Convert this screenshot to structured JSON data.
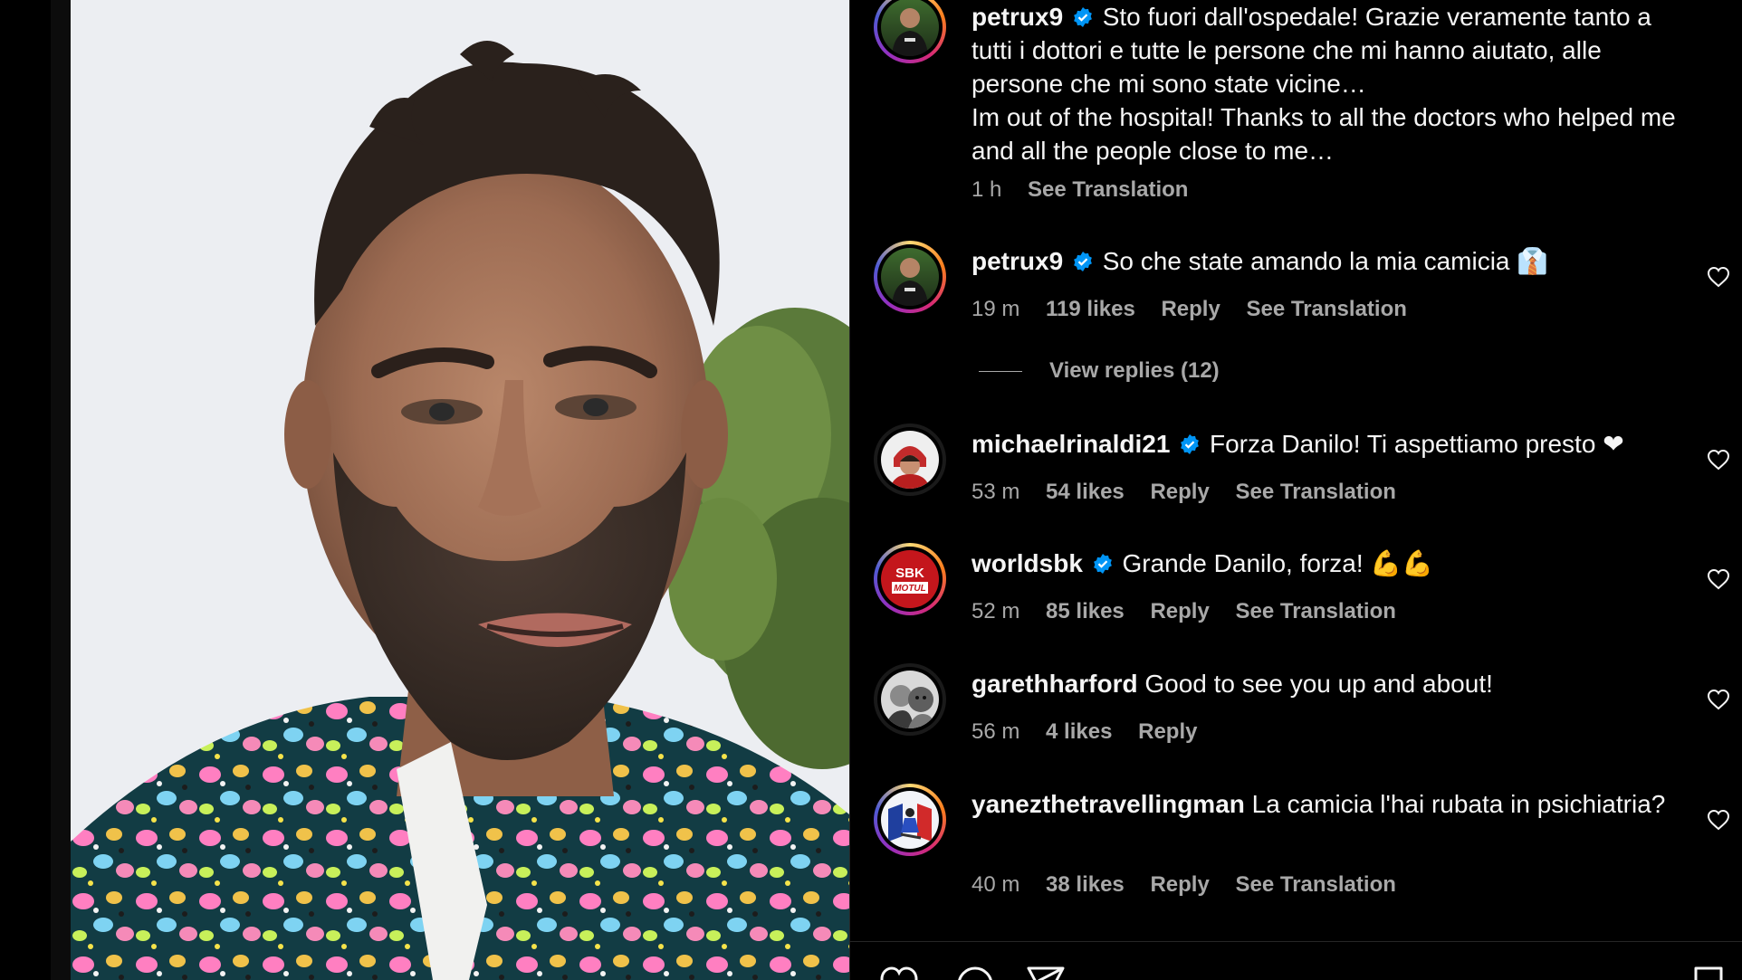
{
  "post": {
    "caption": {
      "username": "petrux9",
      "text_line1": "Sto fuori dall'ospedale! Grazie veramente tanto a tutti i dottori e tutte le persone che mi hanno aiutato, alle persone che mi sono state vicine…",
      "text_line2": "Im out of the hospital! Thanks to all the doctors who helped me and all the people close to me…",
      "time": "1 h",
      "translation": "See Translation"
    }
  },
  "comments": [
    {
      "username": "petrux9",
      "verified": true,
      "text": "So che state amando la mia camicia 👔",
      "time": "19 m",
      "likes": "119 likes",
      "reply": "Reply",
      "translation": "See Translation"
    },
    {
      "username": "michaelrinaldi21",
      "verified": true,
      "text": "Forza Danilo! Ti aspettiamo presto ❤",
      "time": "53 m",
      "likes": "54 likes",
      "reply": "Reply",
      "translation": "See Translation"
    },
    {
      "username": "worldsbk",
      "verified": true,
      "text": "Grande Danilo, forza! 💪💪",
      "time": "52 m",
      "likes": "85 likes",
      "reply": "Reply",
      "translation": "See Translation"
    },
    {
      "username": "garethharford",
      "verified": false,
      "text": "Good to see you up and about!",
      "time": "56 m",
      "likes": "4 likes",
      "reply": "Reply",
      "translation": ""
    },
    {
      "username": "yanezthetravellingman",
      "verified": false,
      "text": "La camicia l'hai rubata in psichiatria?",
      "time": "40 m",
      "likes": "38 likes",
      "reply": "Reply",
      "translation": "See Translation"
    }
  ],
  "view_replies": "View replies (12)",
  "sbk_logo": {
    "top": "SBK",
    "bottom": "MOTUL"
  },
  "icons": [
    "verified-badge-icon",
    "heart-icon",
    "comment-icon",
    "share-icon",
    "save-icon"
  ],
  "colors": {
    "background": "#000000",
    "text": "#f5f5f5",
    "secondary": "#a8a8a8",
    "verified": "#0095f6"
  }
}
